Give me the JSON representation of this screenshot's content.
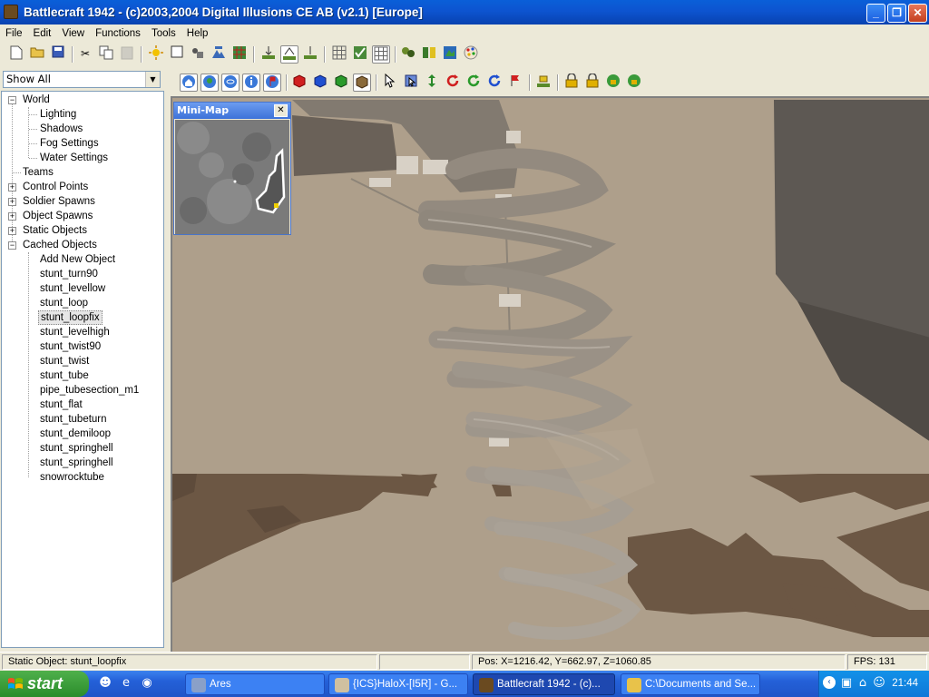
{
  "window": {
    "title": "Battlecraft 1942 - (c)2003,2004 Digital Illusions CE AB (v2.1) [Europe]",
    "minimize_icon": "minimize-icon",
    "maximize_icon": "restore-icon",
    "close_icon": "close-icon"
  },
  "menu": [
    "File",
    "Edit",
    "View",
    "Functions",
    "Tools",
    "Help"
  ],
  "toolbar1": {
    "buttons": [
      "new-file-icon",
      "open-folder-icon",
      "save-icon",
      "cut-icon",
      "copy-icon",
      "paste-icon",
      "sun-icon",
      "panel-icon",
      "object-tool-icon",
      "terrain-tool-icon",
      "grid-color-icon",
      "place-icon",
      "place-active-icon",
      "place-alt-icon",
      "grid-icon",
      "map-check-icon",
      "grid-active-icon",
      "spawn-icon",
      "map-book-icon",
      "world-map-icon",
      "palette-icon"
    ]
  },
  "toolbar2": {
    "buttons": [
      "view-home-icon",
      "view-tree-icon",
      "view-ring-icon",
      "view-info-icon",
      "view-flag-icon",
      "red-cube-icon",
      "blue-cube-icon",
      "green-cube-icon",
      "brown-cube-icon",
      "select-arrow-icon",
      "select-box-icon",
      "move-vertical-icon",
      "rotate-red-icon",
      "rotate-green-icon",
      "rotate-blue-icon",
      "flag-tool-icon",
      "ground-snap-icon",
      "lock-icon",
      "lock-alt-icon",
      "lock-green-icon",
      "lock-circle-icon"
    ]
  },
  "filter": {
    "value": "Show All"
  },
  "tree": {
    "world": {
      "label": "World",
      "children": [
        "Lighting",
        "Shadows",
        "Fog Settings",
        "Water Settings"
      ]
    },
    "top": [
      {
        "label": "Teams",
        "expandable": false
      },
      {
        "label": "Control Points",
        "expandable": true
      },
      {
        "label": "Soldier Spawns",
        "expandable": true
      },
      {
        "label": "Object Spawns",
        "expandable": true
      },
      {
        "label": "Static Objects",
        "expandable": true
      },
      {
        "label": "Cached Objects",
        "expandable": true,
        "expanded": true
      }
    ],
    "cached": [
      "Add New Object",
      "stunt_turn90",
      "stunt_levellow",
      "stunt_loop",
      "stunt_loopfix",
      "stunt_levelhigh",
      "stunt_twist90",
      "stunt_twist",
      "stunt_tube",
      "pipe_tubesection_m1",
      "stunt_flat",
      "stunt_tubeturn",
      "stunt_demiloop",
      "stunt_springhell",
      "stunt_springhell",
      "snowrocktube"
    ],
    "selected": "stunt_loopfix"
  },
  "minimap": {
    "title": "Mini-Map",
    "close_icon": "close-icon"
  },
  "status": {
    "object": "Static Object: stunt_loopfix",
    "pos": "Pos: X=1216.42, Y=662.97, Z=1060.85",
    "fps": "FPS: 131"
  },
  "taskbar": {
    "start": "start",
    "tasks": [
      {
        "label": "Ares",
        "icon": "ares-icon"
      },
      {
        "label": "{ICS}HaloX-[I5R] - G...",
        "icon": "chat-icon"
      },
      {
        "label": "Battlecraft 1942 - (c)...",
        "icon": "battlecraft-icon",
        "active": true
      },
      {
        "label": "C:\\Documents and Se...",
        "icon": "folder-icon"
      }
    ],
    "quicklaunch": [
      "person-icon",
      "ie-icon",
      "media-icon"
    ],
    "tray_icons": [
      "back-icon",
      "monitor-icon",
      "network-icon",
      "user-icon"
    ],
    "clock": "21:44"
  },
  "colors": {
    "titlebar": "#0a5fd8",
    "viewport_ground": "#ae9f8b",
    "ground_dark": "#6c5744",
    "rock": "#5c5651",
    "taskbar": "#245edc",
    "start": "#3a9a35"
  }
}
